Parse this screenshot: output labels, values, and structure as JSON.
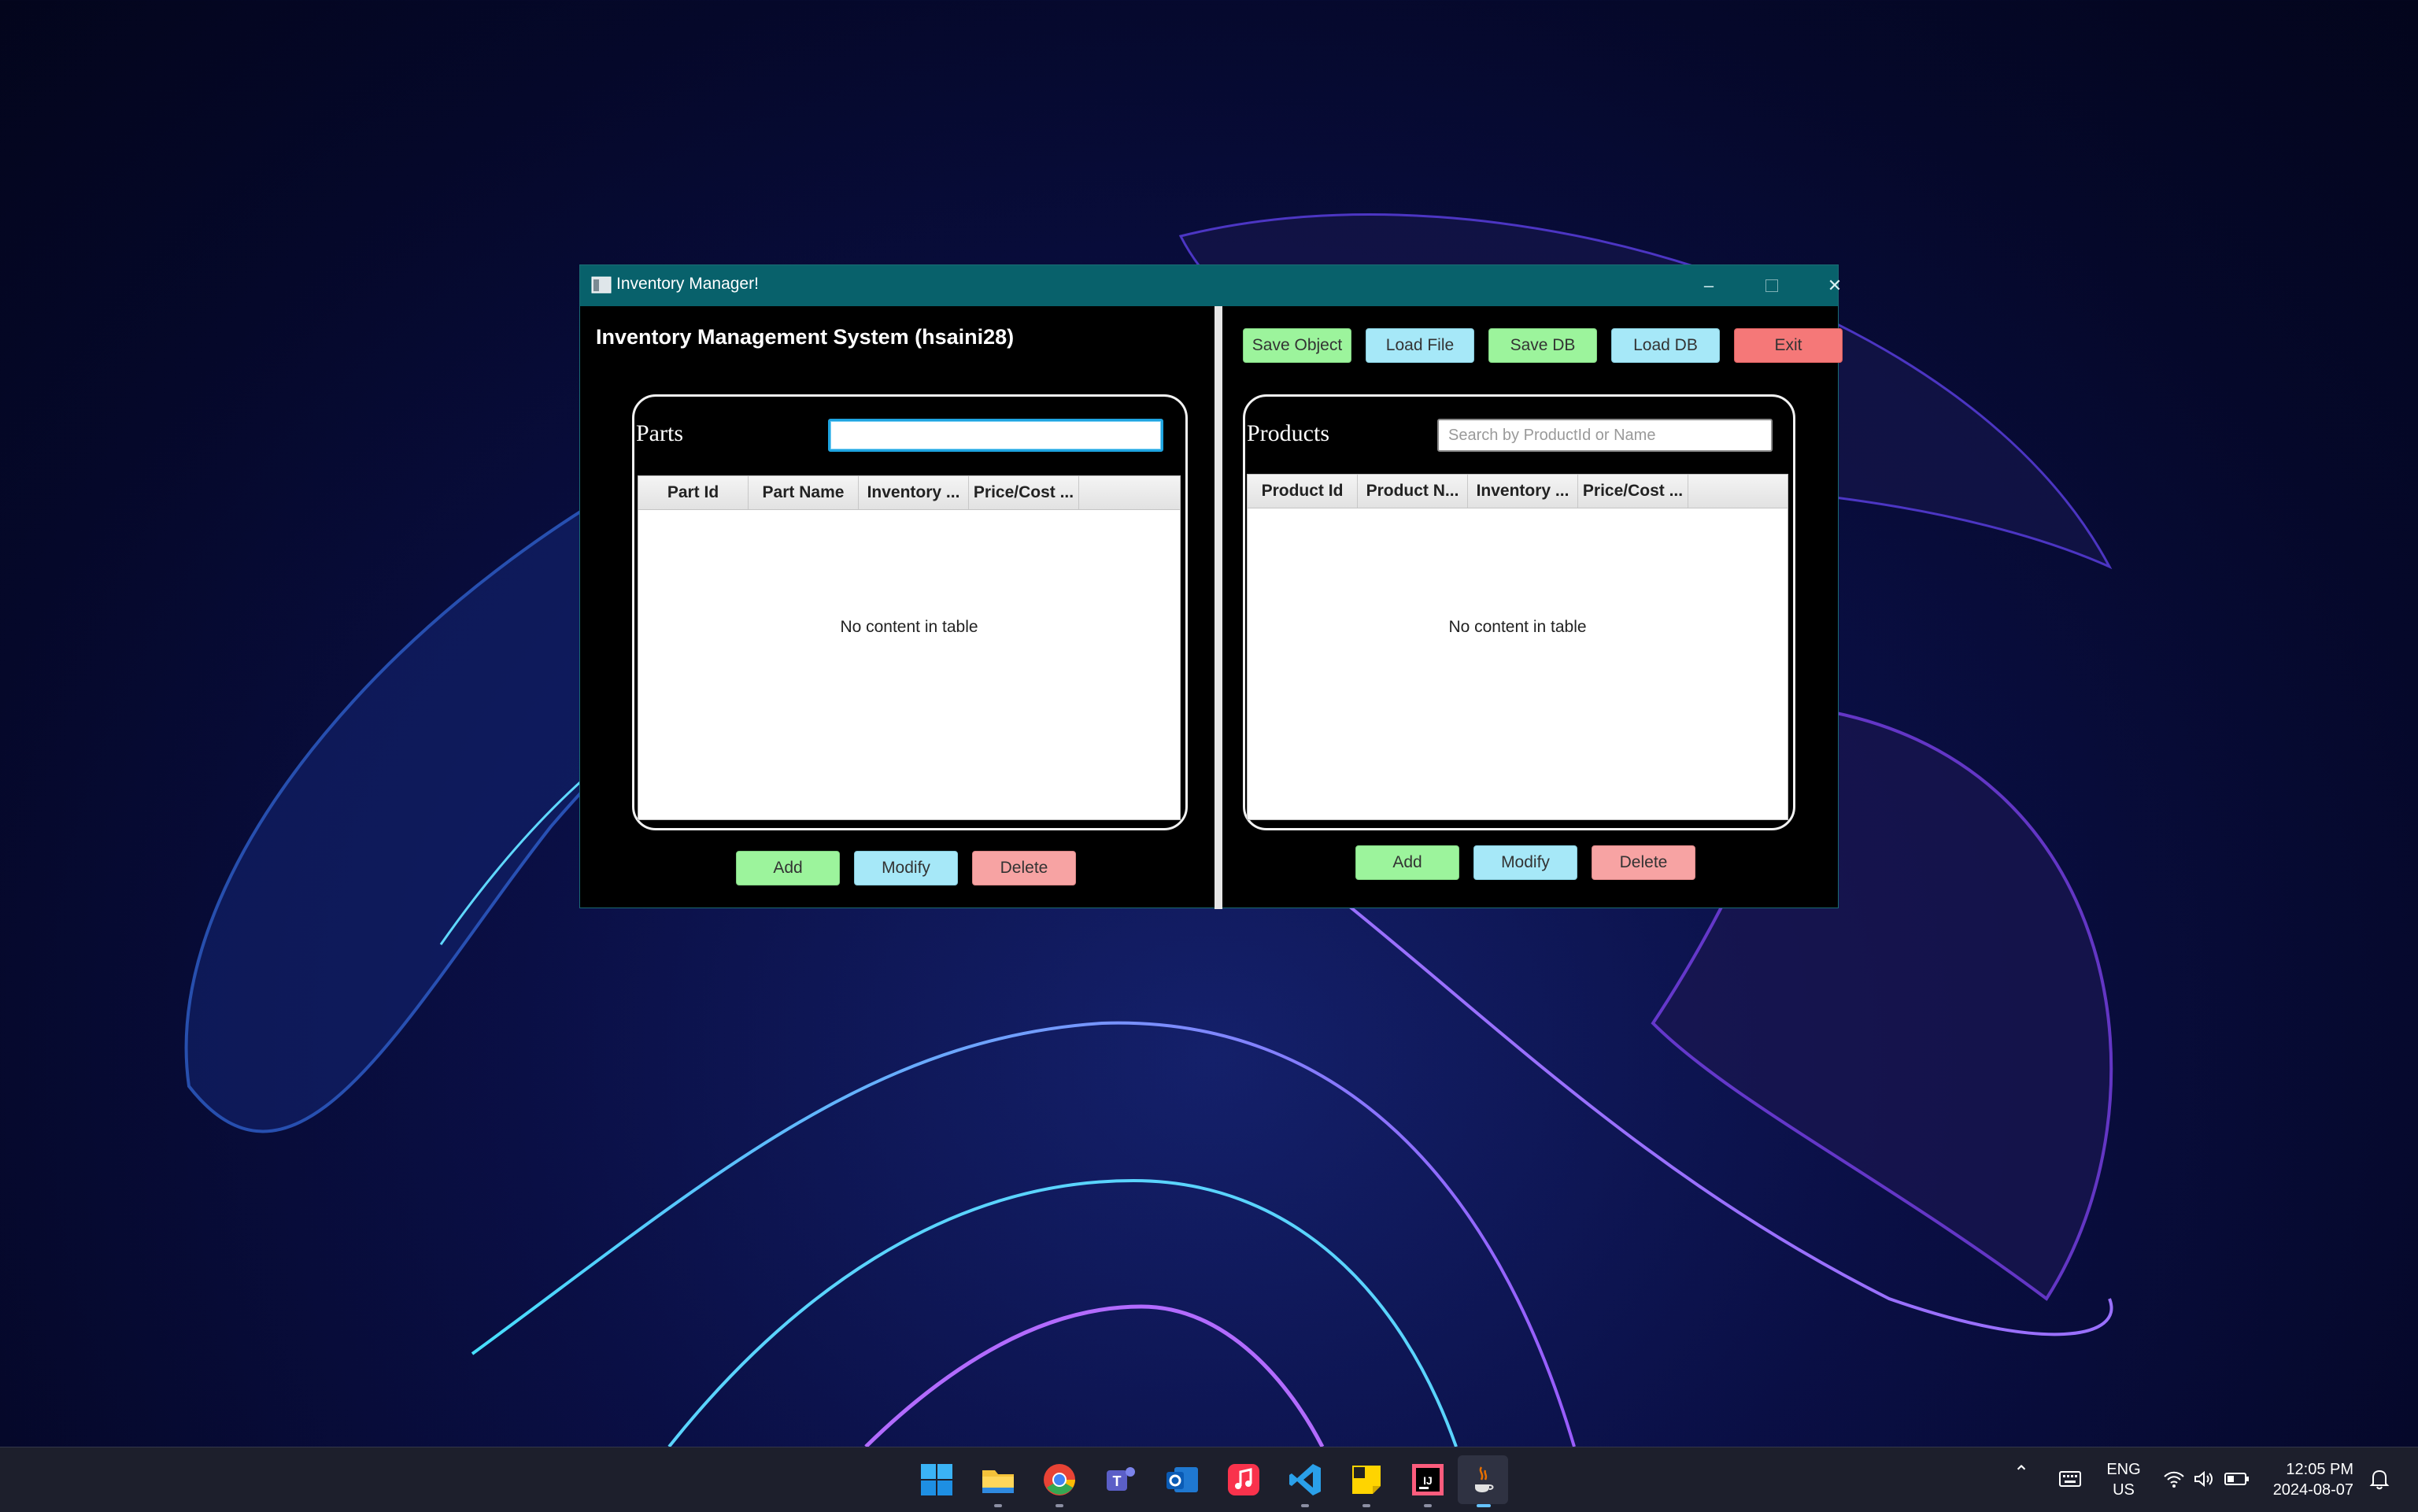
{
  "window": {
    "title": "Inventory Manager!",
    "heading": "Inventory Management System (hsaini28)"
  },
  "toolbar": {
    "save_object": "Save Object",
    "load_file": "Load File",
    "save_db": "Save DB",
    "load_db": "Load DB",
    "exit": "Exit"
  },
  "parts": {
    "label": "Parts",
    "search_value": "",
    "columns": [
      "Part Id",
      "Part Name",
      "Inventory ...",
      "Price/Cost ..."
    ],
    "empty_text": "No content in table",
    "add": "Add",
    "modify": "Modify",
    "delete": "Delete"
  },
  "products": {
    "label": "Products",
    "search_placeholder": "Search by ProductId or Name",
    "columns": [
      "Product Id",
      "Product N...",
      "Inventory ...",
      "Price/Cost ..."
    ],
    "empty_text": "No content in table",
    "add": "Add",
    "modify": "Modify",
    "delete": "Delete"
  },
  "taskbar": {
    "apps": [
      "start-icon",
      "file-explorer-icon",
      "chrome-icon",
      "teams-icon",
      "outlook-icon",
      "music-icon",
      "vscode-icon",
      "sticky-notes-icon",
      "intellij-icon",
      "java-icon"
    ],
    "language_line1": "ENG",
    "language_line2": "US",
    "time": "12:05 PM",
    "date": "2024-08-07"
  },
  "colors": {
    "titlebar": "#08616b",
    "green_button": "#9cf49c",
    "blue_button": "#a6e8f8",
    "pink_button": "#f7a3a3",
    "red_button": "#f57878"
  }
}
